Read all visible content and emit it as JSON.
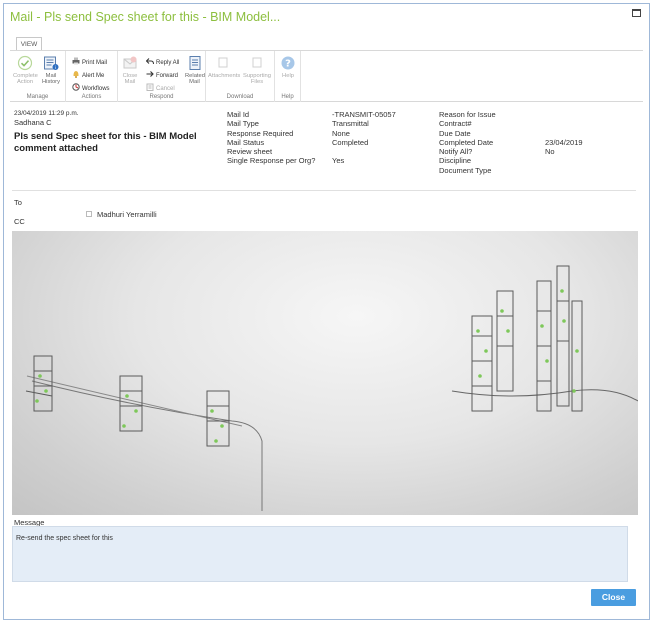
{
  "window": {
    "title": "Mail - Pls send Spec sheet for this - BIM Model..."
  },
  "ribbon": {
    "tab": "VIEW",
    "groups": {
      "manage": "Manage",
      "actions": "Actions",
      "respond": "Respond",
      "download": "Download",
      "help": "Help"
    },
    "buttons": {
      "complete_action": "Complete Action",
      "mail_history": "Mail History",
      "print_mail": "Print Mail",
      "alert_me": "Alert Me",
      "workflows": "Workflows",
      "close_mail": "Close Mail",
      "reply_all": "Reply All",
      "forward": "Forward",
      "cancel": "Cancel",
      "related_mail": "Related Mail",
      "attachments": "Attachments",
      "supporting_files": "Supporting Files",
      "help": "Help"
    }
  },
  "header": {
    "date": "23/04/2019 11:29 p.m.",
    "sender": "Sadhana C",
    "subject": "Pls send Spec sheet for this - BIM Model comment attached"
  },
  "details": {
    "labels1": [
      "Mail Id",
      "Mail Type",
      "Response Required",
      "Mail Status",
      "Review sheet",
      "Single Response per Org?"
    ],
    "values1": [
      "-TRANSMIT-05057",
      "Transmittal",
      "None",
      "Completed",
      "",
      "Yes"
    ],
    "labels2": [
      "Reason for Issue",
      "Contract#",
      "Due Date",
      "Completed Date",
      "Notify All?",
      "Discipline",
      "Document Type"
    ],
    "values2": [
      "",
      "",
      "",
      "23/04/2019",
      "No",
      "",
      ""
    ]
  },
  "recipients": {
    "to_label": "To",
    "cc_label": "CC",
    "to": [
      "Madhuri Yerramilli"
    ]
  },
  "message": {
    "label": "Message",
    "body": "Re-send the spec sheet for this"
  },
  "footer": {
    "close_label": "Close"
  },
  "colors": {
    "title": "#8dbf3f",
    "accent": "#4a9de0",
    "message_bg": "#e4edf7"
  }
}
